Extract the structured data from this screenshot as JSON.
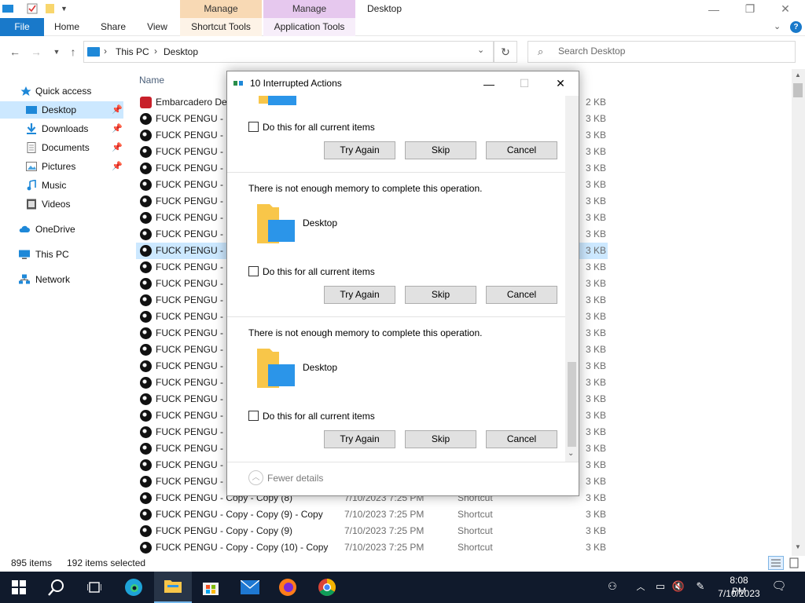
{
  "titlebar": {
    "title": "Desktop",
    "context_tab_heads": [
      "Manage",
      "Manage"
    ],
    "controls": {
      "minimize": "—",
      "maximize": "❐",
      "close": "✕"
    }
  },
  "ribbon": {
    "tabs": [
      "File",
      "Home",
      "Share",
      "View",
      "Shortcut Tools",
      "Application Tools"
    ]
  },
  "address": {
    "crumbs": [
      "This PC",
      "Desktop"
    ],
    "search_placeholder": "Search Desktop"
  },
  "navpane": {
    "items": [
      {
        "label": "Quick access",
        "icon": "star-icon"
      },
      {
        "label": "Desktop",
        "icon": "desktop-icon",
        "selected": true,
        "pinned": true
      },
      {
        "label": "Downloads",
        "icon": "download-icon",
        "pinned": true
      },
      {
        "label": "Documents",
        "icon": "document-icon",
        "pinned": true
      },
      {
        "label": "Pictures",
        "icon": "picture-icon",
        "pinned": true
      },
      {
        "label": "Music",
        "icon": "music-icon"
      },
      {
        "label": "Videos",
        "icon": "video-icon"
      },
      {
        "label": "OneDrive",
        "icon": "cloud-icon"
      },
      {
        "label": "This PC",
        "icon": "pc-icon"
      },
      {
        "label": "Network",
        "icon": "network-icon"
      }
    ]
  },
  "filelist": {
    "column_name": "Name",
    "rows": [
      {
        "name": "Embarcadero Dev",
        "size": "2 KB",
        "icon": "red"
      },
      {
        "name": "FUCK PENGU - C",
        "size": "3 KB"
      },
      {
        "name": "FUCK PENGU - C",
        "size": "3 KB"
      },
      {
        "name": "FUCK PENGU - C",
        "size": "3 KB"
      },
      {
        "name": "FUCK PENGU - C",
        "size": "3 KB"
      },
      {
        "name": "FUCK PENGU - C",
        "size": "3 KB"
      },
      {
        "name": "FUCK PENGU - C",
        "size": "3 KB"
      },
      {
        "name": "FUCK PENGU - C",
        "size": "3 KB"
      },
      {
        "name": "FUCK PENGU - C",
        "size": "3 KB"
      },
      {
        "name": "FUCK PENGU - C",
        "size": "3 KB",
        "selected": true
      },
      {
        "name": "FUCK PENGU - C",
        "size": "3 KB"
      },
      {
        "name": "FUCK PENGU - C",
        "size": "3 KB"
      },
      {
        "name": "FUCK PENGU - C",
        "size": "3 KB"
      },
      {
        "name": "FUCK PENGU - C",
        "size": "3 KB"
      },
      {
        "name": "FUCK PENGU - C",
        "size": "3 KB"
      },
      {
        "name": "FUCK PENGU - C",
        "size": "3 KB"
      },
      {
        "name": "FUCK PENGU - C",
        "size": "3 KB"
      },
      {
        "name": "FUCK PENGU - C",
        "size": "3 KB"
      },
      {
        "name": "FUCK PENGU - C",
        "size": "3 KB"
      },
      {
        "name": "FUCK PENGU - C",
        "size": "3 KB"
      },
      {
        "name": "FUCK PENGU - C",
        "size": "3 KB"
      },
      {
        "name": "FUCK PENGU - C",
        "size": "3 KB"
      },
      {
        "name": "FUCK PENGU - C",
        "size": "3 KB"
      },
      {
        "name": "FUCK PENGU - C",
        "size": "3 KB"
      },
      {
        "name": "FUCK PENGU - Copy - Copy (8)",
        "date": "7/10/2023 7:25 PM",
        "type": "Shortcut",
        "size": "3 KB"
      },
      {
        "name": "FUCK PENGU - Copy - Copy (9) - Copy",
        "date": "7/10/2023 7:25 PM",
        "type": "Shortcut",
        "size": "3 KB"
      },
      {
        "name": "FUCK PENGU - Copy - Copy (9)",
        "date": "7/10/2023 7:25 PM",
        "type": "Shortcut",
        "size": "3 KB"
      },
      {
        "name": "FUCK PENGU - Copy - Copy (10) - Copy",
        "date": "7/10/2023 7:25 PM",
        "type": "Shortcut",
        "size": "3 KB"
      }
    ]
  },
  "statusbar": {
    "items_count": "895 items",
    "selected_count": "192 items selected"
  },
  "dialog": {
    "title": "10 Interrupted Actions",
    "controls": {
      "minimize": "—",
      "maximize": "☐",
      "close": "✕"
    },
    "sections": [
      {
        "checkbox_label": "Do this for all current items",
        "buttons": [
          "Try Again",
          "Skip",
          "Cancel"
        ]
      },
      {
        "message": "There is not enough memory to complete this operation.",
        "folder_label": "Desktop",
        "checkbox_label": "Do this for all current items",
        "buttons": [
          "Try Again",
          "Skip",
          "Cancel"
        ]
      },
      {
        "message": "There is not enough memory to complete this operation.",
        "folder_label": "Desktop",
        "checkbox_label": "Do this for all current items",
        "buttons": [
          "Try Again",
          "Skip",
          "Cancel"
        ]
      }
    ],
    "footer_label": "Fewer details"
  },
  "taskbar": {
    "clock_time": "8:08 PM",
    "clock_date": "7/10/2023",
    "active_app": "file-explorer"
  },
  "colors": {
    "accent": "#1979ca",
    "selection": "#cce8ff",
    "taskbar": "#101a2c",
    "folder": "#f8c649"
  }
}
